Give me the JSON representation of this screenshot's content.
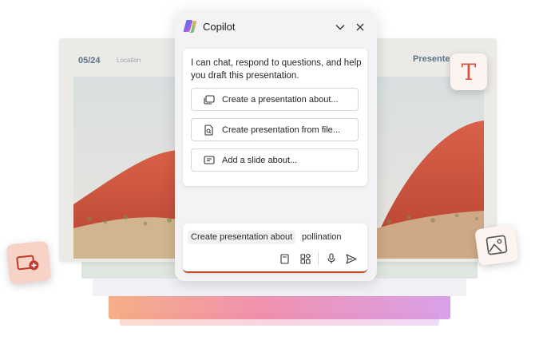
{
  "slide": {
    "date": "05/24",
    "location": "Location",
    "title": "Presente"
  },
  "copilot": {
    "title": "Copilot",
    "intro": "I can chat, respond to questions, and help you draft this presentation.",
    "suggestions": [
      {
        "label": "Create a presentation about...",
        "icon": "slides-icon"
      },
      {
        "label": "Create presentation from file...",
        "icon": "file-search-icon"
      },
      {
        "label": "Add a slide about...",
        "icon": "slide-add-icon"
      }
    ],
    "compose": {
      "prompt_chip": "Create presentation about",
      "prompt_value": "pollination"
    }
  },
  "tiles": {
    "text_tile_letter": "T"
  },
  "colors": {
    "accent": "#c5472b",
    "slide_text": "#5d7488",
    "panel_bg": "#f3f2f4"
  }
}
